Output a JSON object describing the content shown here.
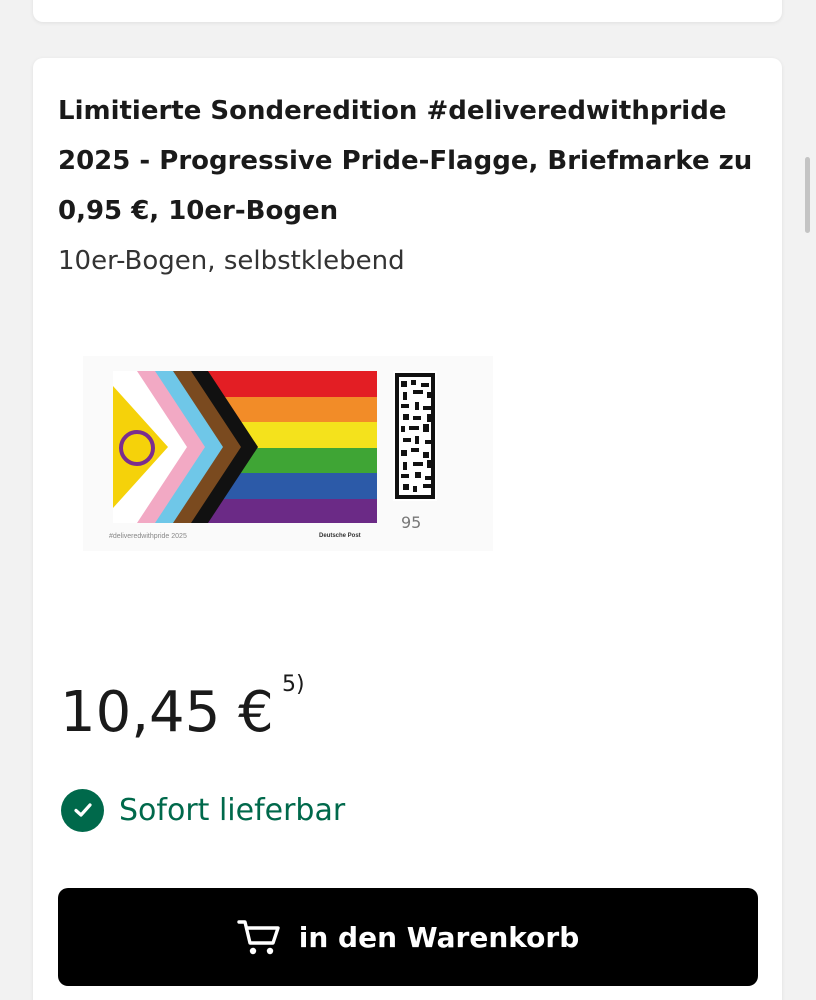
{
  "product": {
    "title": "Limitierte Sonderedition #deliveredwithpride 2025 - Progressive Pride-Flagge, Briefmarke zu 0,95 €, 10er-Bogen",
    "subtitle": "10er-Bogen, selbstklebend"
  },
  "stamp": {
    "caption": "#deliveredwithpride 2025",
    "brand": "Deutsche Post",
    "value": "95"
  },
  "price": {
    "amount": "10,45 €",
    "footnote": "5)"
  },
  "availability": {
    "label": "Sofort lieferbar",
    "color": "#00694b"
  },
  "cart_button": {
    "label": "in den Warenkorb",
    "icon": "cart-icon"
  }
}
